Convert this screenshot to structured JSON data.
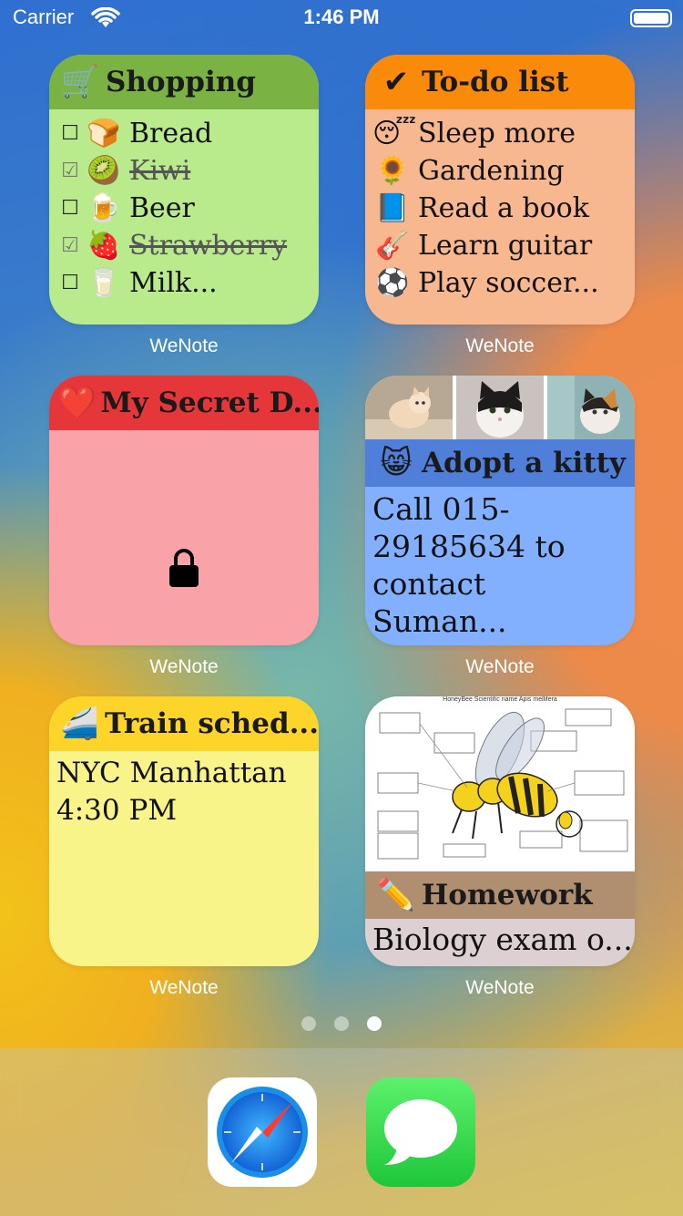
{
  "status_bar": {
    "carrier": "Carrier",
    "time": "1:46 PM",
    "battery_level": 1.0
  },
  "widgets": {
    "shopping": {
      "icon": "🛒",
      "title": "Shopping",
      "app_label": "WeNote",
      "header_color": "#7ab344",
      "body_color": "#b9ea8c",
      "items": [
        {
          "checked": false,
          "emoji": "🍞",
          "text": "Bread"
        },
        {
          "checked": true,
          "emoji": "🥝",
          "text": "Kiwi"
        },
        {
          "checked": false,
          "emoji": "🍺",
          "text": "Beer"
        },
        {
          "checked": true,
          "emoji": "🍓",
          "text": "Strawberry"
        },
        {
          "checked": false,
          "emoji": "🥛",
          "text": "Milk..."
        }
      ]
    },
    "todo": {
      "icon": "✔",
      "title": "To-do list",
      "app_label": "WeNote",
      "header_color": "#f98a0a",
      "body_color": "#f8b88f",
      "items": [
        {
          "emoji": "😴",
          "text": "Sleep more"
        },
        {
          "emoji": "🌻",
          "text": "Gardening"
        },
        {
          "emoji": "📘",
          "text": "Read a book"
        },
        {
          "emoji": "🎸",
          "text": "Learn guitar"
        },
        {
          "emoji": "⚽",
          "text": "Play soccer..."
        }
      ]
    },
    "secret": {
      "icon": "❤️",
      "title": "My Secret D...",
      "app_label": "WeNote",
      "header_color": "#e5373a",
      "body_color": "#f9a2a8",
      "lock_icon": "lock-icon"
    },
    "kitty": {
      "icon": "😸",
      "title": "Adopt a kitty",
      "app_label": "WeNote",
      "header_color": "#4f7fd9",
      "body_color": "#82b0ff",
      "body_text": "Call 015-29185634 to contact Suman..."
    },
    "train": {
      "icon": "🚄",
      "title": "Train sched...",
      "app_label": "WeNote",
      "header_color": "#fdd42a",
      "body_color": "#f8f48a",
      "lines": [
        "NYC Manhattan",
        "4:30 PM"
      ]
    },
    "homework": {
      "icon": "✏️",
      "title": "Homework",
      "app_label": "WeNote",
      "header_color": "#b08f71",
      "body_color": "#dcd0d3",
      "body_text": "Biology exam o...",
      "diagram_title": "HoneyBee Scientific name Apis mellifera"
    }
  },
  "page_dots": {
    "count": 3,
    "active_index": 2
  },
  "dock": {
    "apps": [
      {
        "icon": "safari-icon"
      },
      {
        "icon": "messages-icon"
      }
    ]
  }
}
